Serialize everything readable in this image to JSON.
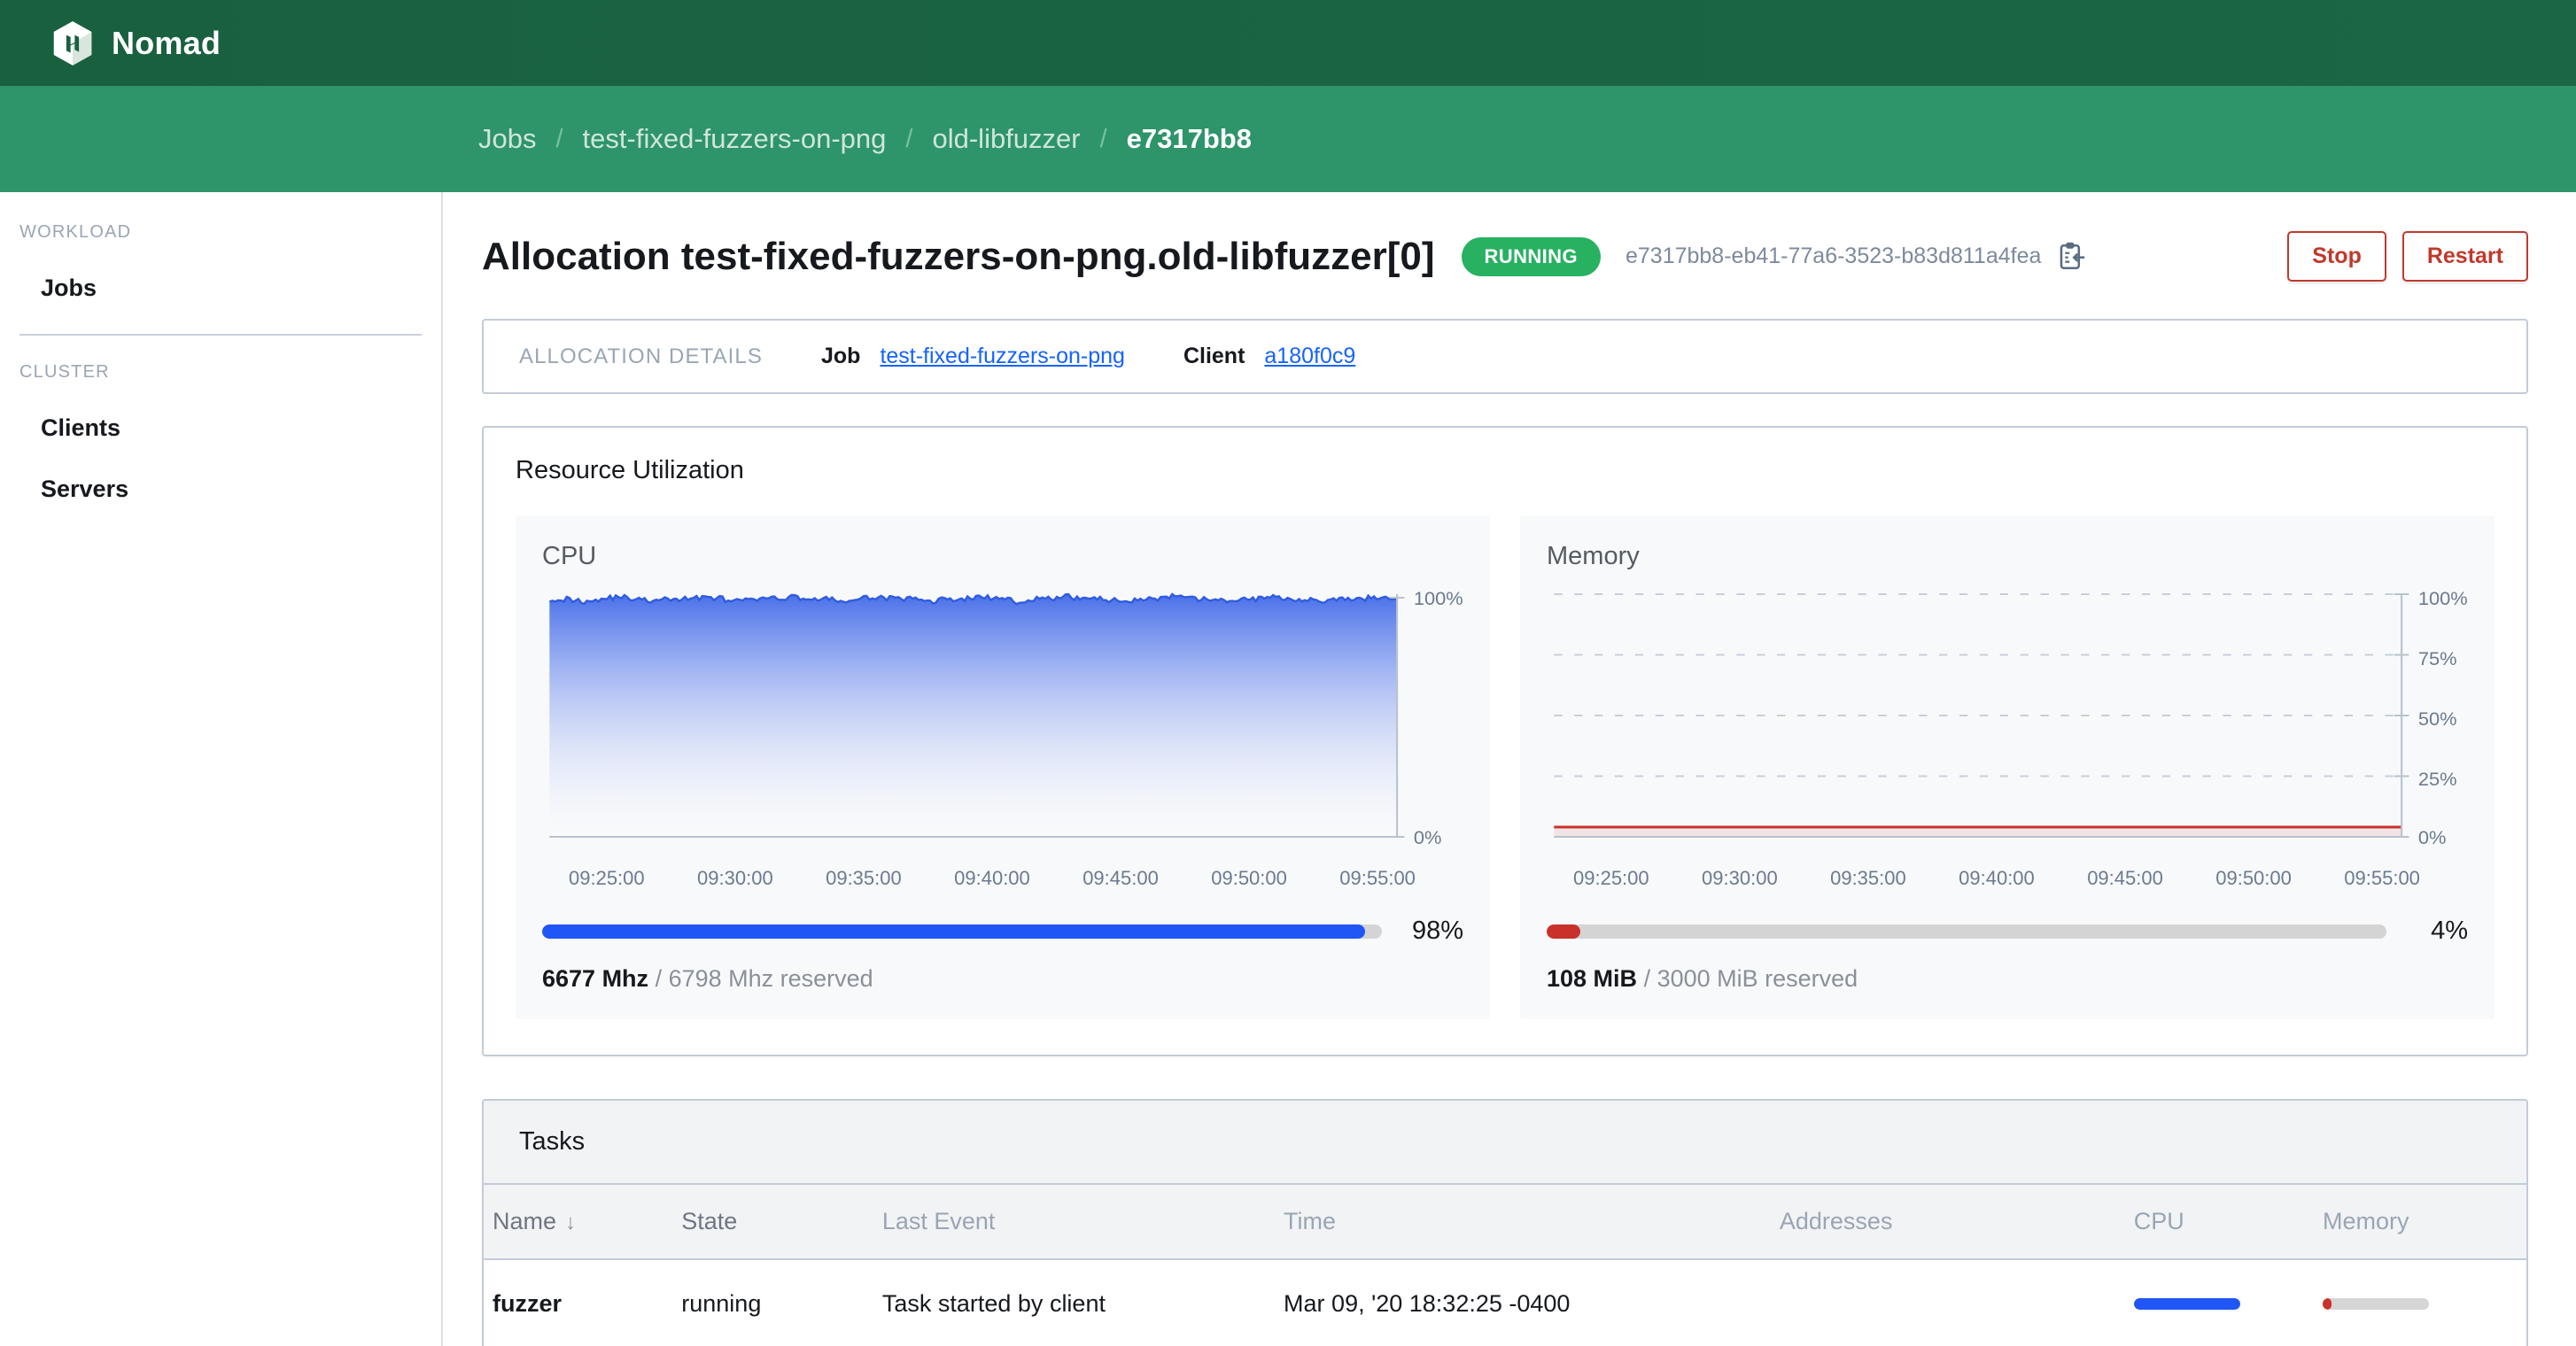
{
  "brand": {
    "name": "Nomad",
    "logo_icon": "nomad-hexagon-logo"
  },
  "breadcrumbs": [
    {
      "label": "Jobs",
      "active": false
    },
    {
      "label": "test-fixed-fuzzers-on-png",
      "active": false
    },
    {
      "label": "old-libfuzzer",
      "active": false
    },
    {
      "label": "e7317bb8",
      "active": true
    }
  ],
  "breadcrumb_separator": "/",
  "sidebar": {
    "sections": [
      {
        "title": "WORKLOAD",
        "items": [
          {
            "label": "Jobs"
          }
        ]
      },
      {
        "title": "CLUSTER",
        "items": [
          {
            "label": "Clients"
          },
          {
            "label": "Servers"
          }
        ]
      }
    ]
  },
  "header": {
    "title": "Allocation test-fixed-fuzzers-on-png.old-libfuzzer[0]",
    "status": "RUNNING",
    "allocation_id": "e7317bb8-eb41-77a6-3523-b83d811a4fea",
    "copy_icon": "clipboard-copy-icon",
    "stop_label": "Stop",
    "restart_label": "Restart"
  },
  "allocation_details": {
    "label": "ALLOCATION DETAILS",
    "job_key": "Job",
    "job_value": "test-fixed-fuzzers-on-png",
    "client_key": "Client",
    "client_value": "a180f0c9"
  },
  "resource_utilization": {
    "title": "Resource Utilization",
    "cpu": {
      "title": "CPU",
      "percent_label": "98%",
      "percent": 98,
      "used": "6677 Mhz",
      "reserved": "/ 6798 Mhz reserved",
      "color": "#1f56f5"
    },
    "memory": {
      "title": "Memory",
      "percent_label": "4%",
      "percent": 4,
      "used": "108 MiB",
      "reserved": "/ 3000 MiB reserved",
      "color": "#c8322a"
    }
  },
  "chart_data": [
    {
      "type": "area",
      "title": "CPU",
      "xlabel": "",
      "ylabel": "",
      "ylim": [
        0,
        100
      ],
      "ytick_labels": [
        "100%",
        "0%"
      ],
      "yticks": [
        100,
        0
      ],
      "grid": false,
      "legend": "none",
      "x": [
        "09:25:00",
        "09:30:00",
        "09:35:00",
        "09:40:00",
        "09:45:00",
        "09:50:00",
        "09:55:00"
      ],
      "xtick_labels": [
        "09:25:00",
        "09:30:00",
        "09:35:00",
        "09:40:00",
        "09:45:00",
        "09:50:00",
        "09:55:00"
      ],
      "series": [
        {
          "name": "CPU %",
          "color": "#2f5ce0",
          "values": [
            98,
            98,
            97,
            98,
            99,
            98,
            97,
            98,
            98,
            99,
            98,
            97,
            98,
            98,
            99,
            98,
            98,
            97,
            98,
            99,
            98,
            98,
            97,
            98,
            98,
            99,
            98,
            97,
            98,
            98,
            99,
            98,
            98,
            97,
            98,
            98,
            99,
            98,
            98,
            97,
            98,
            98,
            99,
            98,
            98,
            97,
            98,
            98,
            99,
            98
          ]
        }
      ]
    },
    {
      "type": "line",
      "title": "Memory",
      "xlabel": "",
      "ylabel": "",
      "ylim": [
        0,
        100
      ],
      "ytick_labels": [
        "100%",
        "75%",
        "50%",
        "25%",
        "0%"
      ],
      "yticks": [
        100,
        75,
        50,
        25,
        0
      ],
      "grid": true,
      "legend": "none",
      "x": [
        "09:25:00",
        "09:30:00",
        "09:35:00",
        "09:40:00",
        "09:45:00",
        "09:50:00",
        "09:55:00"
      ],
      "xtick_labels": [
        "09:25:00",
        "09:30:00",
        "09:35:00",
        "09:40:00",
        "09:45:00",
        "09:50:00",
        "09:55:00"
      ],
      "series": [
        {
          "name": "Memory %",
          "color": "#c8322a",
          "values": [
            4,
            4,
            4,
            4,
            4,
            4,
            4,
            4,
            4,
            4,
            4,
            4,
            4,
            4,
            4,
            4,
            4,
            4,
            4,
            4,
            4,
            4,
            4,
            4,
            4,
            4,
            4,
            4,
            4,
            4,
            4,
            4,
            4,
            4,
            4,
            4,
            4,
            4,
            4,
            4,
            4,
            4,
            4,
            4,
            4,
            4,
            4,
            4,
            4,
            4
          ]
        }
      ]
    }
  ],
  "tasks": {
    "title": "Tasks",
    "columns": [
      "Name",
      "State",
      "Last Event",
      "Time",
      "Addresses",
      "CPU",
      "Memory"
    ],
    "sort_column": "Name",
    "sort_arrow": "↓",
    "rows": [
      {
        "name": "fuzzer",
        "state": "running",
        "last_event": "Task started by client",
        "time": "Mar 09, '20 18:32:25 -0400",
        "addresses": "",
        "cpu_percent": 100,
        "memory_percent": 8
      }
    ]
  }
}
